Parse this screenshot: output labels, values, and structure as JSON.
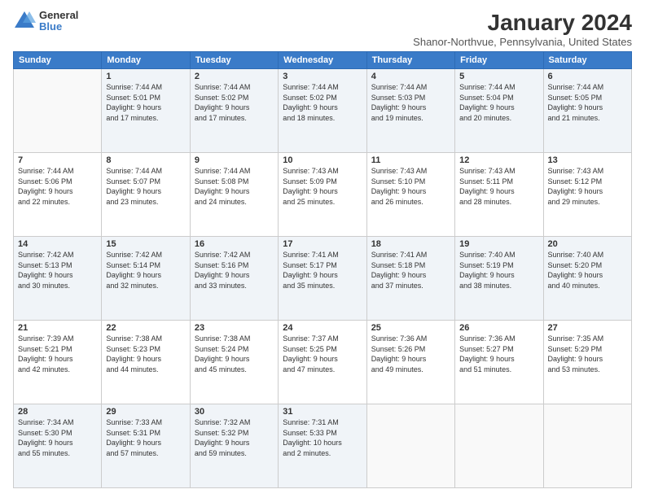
{
  "logo": {
    "general": "General",
    "blue": "Blue"
  },
  "title": "January 2024",
  "subtitle": "Shanor-Northvue, Pennsylvania, United States",
  "days_header": [
    "Sunday",
    "Monday",
    "Tuesday",
    "Wednesday",
    "Thursday",
    "Friday",
    "Saturday"
  ],
  "weeks": [
    [
      {
        "num": "",
        "info": ""
      },
      {
        "num": "1",
        "info": "Sunrise: 7:44 AM\nSunset: 5:01 PM\nDaylight: 9 hours\nand 17 minutes."
      },
      {
        "num": "2",
        "info": "Sunrise: 7:44 AM\nSunset: 5:02 PM\nDaylight: 9 hours\nand 17 minutes."
      },
      {
        "num": "3",
        "info": "Sunrise: 7:44 AM\nSunset: 5:02 PM\nDaylight: 9 hours\nand 18 minutes."
      },
      {
        "num": "4",
        "info": "Sunrise: 7:44 AM\nSunset: 5:03 PM\nDaylight: 9 hours\nand 19 minutes."
      },
      {
        "num": "5",
        "info": "Sunrise: 7:44 AM\nSunset: 5:04 PM\nDaylight: 9 hours\nand 20 minutes."
      },
      {
        "num": "6",
        "info": "Sunrise: 7:44 AM\nSunset: 5:05 PM\nDaylight: 9 hours\nand 21 minutes."
      }
    ],
    [
      {
        "num": "7",
        "info": "Sunrise: 7:44 AM\nSunset: 5:06 PM\nDaylight: 9 hours\nand 22 minutes."
      },
      {
        "num": "8",
        "info": "Sunrise: 7:44 AM\nSunset: 5:07 PM\nDaylight: 9 hours\nand 23 minutes."
      },
      {
        "num": "9",
        "info": "Sunrise: 7:44 AM\nSunset: 5:08 PM\nDaylight: 9 hours\nand 24 minutes."
      },
      {
        "num": "10",
        "info": "Sunrise: 7:43 AM\nSunset: 5:09 PM\nDaylight: 9 hours\nand 25 minutes."
      },
      {
        "num": "11",
        "info": "Sunrise: 7:43 AM\nSunset: 5:10 PM\nDaylight: 9 hours\nand 26 minutes."
      },
      {
        "num": "12",
        "info": "Sunrise: 7:43 AM\nSunset: 5:11 PM\nDaylight: 9 hours\nand 28 minutes."
      },
      {
        "num": "13",
        "info": "Sunrise: 7:43 AM\nSunset: 5:12 PM\nDaylight: 9 hours\nand 29 minutes."
      }
    ],
    [
      {
        "num": "14",
        "info": "Sunrise: 7:42 AM\nSunset: 5:13 PM\nDaylight: 9 hours\nand 30 minutes."
      },
      {
        "num": "15",
        "info": "Sunrise: 7:42 AM\nSunset: 5:14 PM\nDaylight: 9 hours\nand 32 minutes."
      },
      {
        "num": "16",
        "info": "Sunrise: 7:42 AM\nSunset: 5:16 PM\nDaylight: 9 hours\nand 33 minutes."
      },
      {
        "num": "17",
        "info": "Sunrise: 7:41 AM\nSunset: 5:17 PM\nDaylight: 9 hours\nand 35 minutes."
      },
      {
        "num": "18",
        "info": "Sunrise: 7:41 AM\nSunset: 5:18 PM\nDaylight: 9 hours\nand 37 minutes."
      },
      {
        "num": "19",
        "info": "Sunrise: 7:40 AM\nSunset: 5:19 PM\nDaylight: 9 hours\nand 38 minutes."
      },
      {
        "num": "20",
        "info": "Sunrise: 7:40 AM\nSunset: 5:20 PM\nDaylight: 9 hours\nand 40 minutes."
      }
    ],
    [
      {
        "num": "21",
        "info": "Sunrise: 7:39 AM\nSunset: 5:21 PM\nDaylight: 9 hours\nand 42 minutes."
      },
      {
        "num": "22",
        "info": "Sunrise: 7:38 AM\nSunset: 5:23 PM\nDaylight: 9 hours\nand 44 minutes."
      },
      {
        "num": "23",
        "info": "Sunrise: 7:38 AM\nSunset: 5:24 PM\nDaylight: 9 hours\nand 45 minutes."
      },
      {
        "num": "24",
        "info": "Sunrise: 7:37 AM\nSunset: 5:25 PM\nDaylight: 9 hours\nand 47 minutes."
      },
      {
        "num": "25",
        "info": "Sunrise: 7:36 AM\nSunset: 5:26 PM\nDaylight: 9 hours\nand 49 minutes."
      },
      {
        "num": "26",
        "info": "Sunrise: 7:36 AM\nSunset: 5:27 PM\nDaylight: 9 hours\nand 51 minutes."
      },
      {
        "num": "27",
        "info": "Sunrise: 7:35 AM\nSunset: 5:29 PM\nDaylight: 9 hours\nand 53 minutes."
      }
    ],
    [
      {
        "num": "28",
        "info": "Sunrise: 7:34 AM\nSunset: 5:30 PM\nDaylight: 9 hours\nand 55 minutes."
      },
      {
        "num": "29",
        "info": "Sunrise: 7:33 AM\nSunset: 5:31 PM\nDaylight: 9 hours\nand 57 minutes."
      },
      {
        "num": "30",
        "info": "Sunrise: 7:32 AM\nSunset: 5:32 PM\nDaylight: 9 hours\nand 59 minutes."
      },
      {
        "num": "31",
        "info": "Sunrise: 7:31 AM\nSunset: 5:33 PM\nDaylight: 10 hours\nand 2 minutes."
      },
      {
        "num": "",
        "info": ""
      },
      {
        "num": "",
        "info": ""
      },
      {
        "num": "",
        "info": ""
      }
    ]
  ]
}
